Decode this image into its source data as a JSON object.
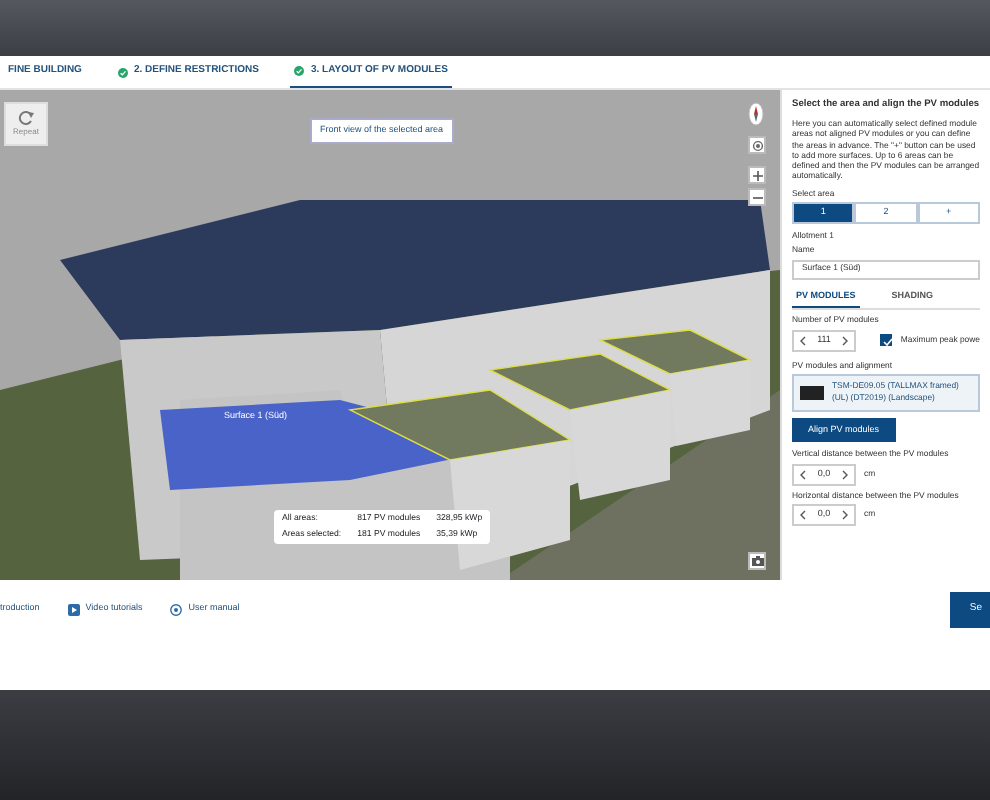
{
  "tabs": [
    {
      "label": "FINE BUILDING",
      "completed": false,
      "selected": false
    },
    {
      "label": "2. DEFINE RESTRICTIONS",
      "completed": true,
      "selected": false
    },
    {
      "label": "3. LAYOUT OF PV MODULES",
      "completed": true,
      "selected": true
    }
  ],
  "viewer": {
    "repeat_label": "Repeat",
    "tooltip": "Front view of the selected area",
    "surface_label": "Surface 1 (Süd)",
    "stats": [
      {
        "label": "All areas:",
        "modules": "817 PV modules",
        "power": "328,95 kWp"
      },
      {
        "label": "Areas selected:",
        "modules": "181 PV modules",
        "power": "35,39 kWp"
      }
    ]
  },
  "panel": {
    "title": "Select the area and align the PV modules",
    "intro": "Here you can automatically select defined module areas not aligned PV modules or you can define the areas in advance. The \"+\" button can be used to add more surfaces. Up to 6 areas can be defined and then the PV modules can be arranged automatically.",
    "area_label": "Select area",
    "areas": [
      {
        "label": "1",
        "selected": true
      },
      {
        "label": "2",
        "selected": false
      },
      {
        "label": "+",
        "selected": false
      }
    ],
    "allotment": "Allotment 1",
    "name_label": "Name",
    "name_value": "Surface 1 (Süd)",
    "subtabs": [
      {
        "label": "PV MODULES",
        "selected": true
      },
      {
        "label": "SHADING",
        "selected": false
      }
    ],
    "count_label": "Number of PV modules",
    "count_value": "111",
    "max_power": {
      "label": "Maximum peak powe",
      "checked": true
    },
    "module_label": "PV modules and alignment",
    "module_text": "TSM-DE09.05 (TALLMAX framed) (UL) (DT2019) (Landscape)",
    "align_button": "Align PV modules",
    "distances": [
      {
        "label": "Vertical distance between the PV modules",
        "value": "0,0",
        "unit": "cm"
      },
      {
        "label": "Horizontal distance between the PV modules",
        "value": "0,0",
        "unit": "cm"
      }
    ]
  },
  "footer": {
    "links": [
      {
        "label": "troduction"
      },
      {
        "label": "Video tutorials"
      },
      {
        "label": "User manual"
      }
    ],
    "button": "Se"
  }
}
